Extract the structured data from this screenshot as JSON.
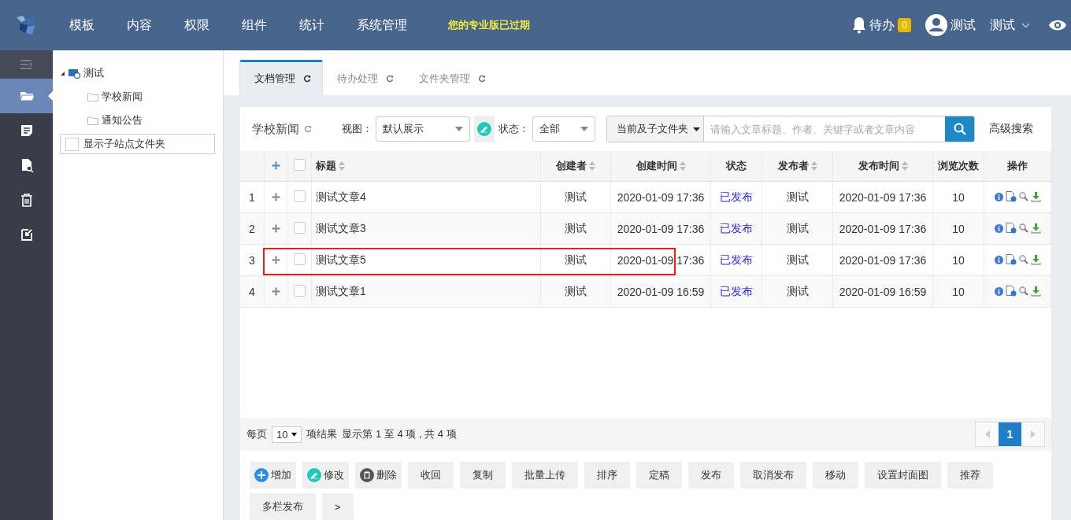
{
  "header": {
    "nav": [
      "模板",
      "内容",
      "权限",
      "组件",
      "统计",
      "系统管理"
    ],
    "notice": "您的专业版已过期",
    "todo": {
      "label": "待办",
      "count": "0"
    },
    "user": "测试",
    "user_menu": "测试"
  },
  "sidebar": {
    "items": [
      {
        "selected": true
      },
      {
        "selected": false
      },
      {
        "selected": false
      },
      {
        "selected": false
      },
      {
        "selected": false
      }
    ]
  },
  "tree": {
    "root": {
      "label": "测试",
      "expanded": true,
      "children": [
        {
          "label": "学校新闻"
        },
        {
          "label": "通知公告"
        }
      ]
    },
    "option": {
      "label": "显示子站点文件夹",
      "checked": false
    }
  },
  "tabs": [
    {
      "label": "文档管理",
      "selected": true
    },
    {
      "label": "待办处理",
      "selected": false
    },
    {
      "label": "文件夹管理",
      "selected": false
    }
  ],
  "toolbar": {
    "folder": "学校新闻",
    "view_label": "视图：",
    "view": "默认展示",
    "status_label": "状态：",
    "status": "全部",
    "scope": "当前及子文件夹",
    "search_placeholder": "请输入文章标题、作者、关键字或者文章内容",
    "advanced": "高级搜索"
  },
  "table": {
    "select_all_checked": false,
    "columns": [
      {
        "label": "标题",
        "sortable": true
      },
      {
        "label": "创建者",
        "sortable": true
      },
      {
        "label": "创建时间",
        "sortable": true
      },
      {
        "label": "状态",
        "sortable": false
      },
      {
        "label": "发布者",
        "sortable": true
      },
      {
        "label": "发布时间",
        "sortable": true
      },
      {
        "label": "浏览次数",
        "sortable": false
      },
      {
        "label": "操作",
        "sortable": false
      }
    ],
    "rows": [
      {
        "index": "1",
        "title": "测试文章4",
        "creator": "测试",
        "created": "2020-01-09 17:36",
        "status": "已发布",
        "publisher": "测试",
        "published": "2020-01-09 17:36",
        "views": "10",
        "checked": false,
        "highlighted": false
      },
      {
        "index": "2",
        "title": "测试文章3",
        "creator": "测试",
        "created": "2020-01-09 17:36",
        "status": "已发布",
        "publisher": "测试",
        "published": "2020-01-09 17:36",
        "views": "10",
        "checked": false,
        "highlighted": false
      },
      {
        "index": "3",
        "title": "测试文章5",
        "creator": "测试",
        "created": "2020-01-09 17:36",
        "status": "已发布",
        "publisher": "测试",
        "published": "2020-01-09 17:36",
        "views": "10",
        "checked": false,
        "highlighted": true
      },
      {
        "index": "4",
        "title": "测试文章1",
        "creator": "测试",
        "created": "2020-01-09 16:59",
        "status": "已发布",
        "publisher": "测试",
        "published": "2020-01-09 16:59",
        "views": "10",
        "checked": false,
        "highlighted": false
      }
    ]
  },
  "pagination": {
    "per_page_label": "每页",
    "per_page": "10",
    "after": "项结果",
    "summary": "显示第 1 至 4 项 , 共 4 项",
    "pages": [
      {
        "label": "1",
        "selected": true
      }
    ]
  },
  "actions": [
    {
      "label": "增加",
      "kind": "add"
    },
    {
      "label": "修改",
      "kind": "edit"
    },
    {
      "label": "删除",
      "kind": "delete"
    },
    {
      "label": "收回",
      "kind": "plain"
    },
    {
      "label": "复制",
      "kind": "plain"
    },
    {
      "label": "批量上传",
      "kind": "plain"
    },
    {
      "label": "排序",
      "kind": "plain"
    },
    {
      "label": "定稿",
      "kind": "plain"
    },
    {
      "label": "发布",
      "kind": "plain"
    },
    {
      "label": "取消发布",
      "kind": "plain"
    },
    {
      "label": "移动",
      "kind": "plain"
    },
    {
      "label": "设置封面图",
      "kind": "plain"
    },
    {
      "label": "推荐",
      "kind": "plain"
    },
    {
      "label": "多栏发布",
      "kind": "plain"
    },
    {
      "label": ">",
      "kind": "plain"
    }
  ]
}
